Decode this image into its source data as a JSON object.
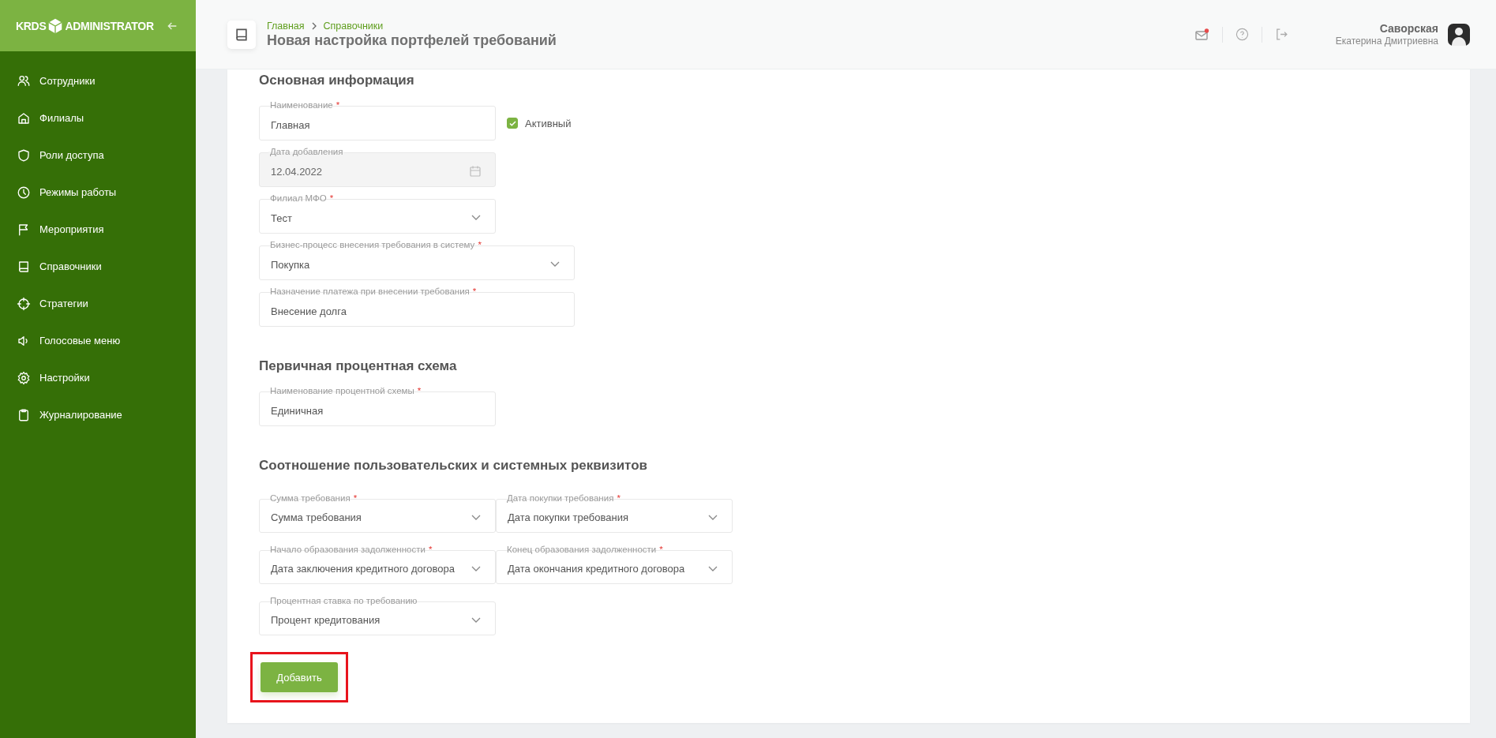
{
  "sidebar": {
    "logo_left": "KRDS",
    "logo_right": "ADMINISTRATOR",
    "items": [
      {
        "label": "Сотрудники",
        "selected": false
      },
      {
        "label": "Филиалы",
        "selected": false
      },
      {
        "label": "Роли доступа",
        "selected": false
      },
      {
        "label": "Режимы работы",
        "selected": false
      },
      {
        "label": "Мероприятия",
        "selected": false
      },
      {
        "label": "Справочники",
        "selected": false
      },
      {
        "label": "Стратегии",
        "selected": false
      },
      {
        "label": "Голосовые меню",
        "selected": false
      },
      {
        "label": "Настройки",
        "selected": false
      },
      {
        "label": "Журналирование",
        "selected": false
      }
    ]
  },
  "header": {
    "breadcrumbs": [
      "Главная",
      "Справочники"
    ],
    "title": "Новая настройка портфелей требований",
    "mail_unread": true,
    "user": {
      "surname": "Саворская",
      "name": "Екатерина Дмитриевна"
    }
  },
  "sections": [
    {
      "title": "Основная информация",
      "fields": [
        {
          "kind": "input",
          "label": "Наименование",
          "required_mark": "*",
          "disabled": false,
          "value": "Главная"
        },
        {
          "kind": "date",
          "label": "Дата добавления",
          "disabled": true,
          "value": "12.04.2022"
        },
        {
          "kind": "select",
          "label": "Филиал МФО",
          "required_mark": "*",
          "disabled": false,
          "value": "Тест"
        },
        {
          "kind": "select",
          "label": "Бизнес-процесс внесения требования в систему",
          "required_mark": "*",
          "disabled": false,
          "value": "Покупка"
        },
        {
          "kind": "input",
          "label": "Назначение платежа при внесении требования",
          "required_mark": "*",
          "disabled": false,
          "value": "Внесение долга"
        }
      ],
      "checkbox": {
        "label": "Активный",
        "checked": true
      }
    },
    {
      "title": "Первичная процентная схема",
      "fields": [
        {
          "kind": "input",
          "label": "Наименование процентной схемы",
          "required_mark": "*",
          "disabled": false,
          "value": "Единичная"
        }
      ]
    },
    {
      "title": "Соотношение пользовательских и системных реквизитов",
      "fields": [
        {
          "kind": "select",
          "label": "Сумма требования",
          "required_mark": "*",
          "disabled": false,
          "value": "Сумма требования"
        },
        {
          "kind": "select",
          "label": "Дата покупки требования",
          "required_mark": "*",
          "disabled": false,
          "value": "Дата покупки требования"
        },
        {
          "kind": "select",
          "label": "Начало образования задолженности",
          "required_mark": "*",
          "disabled": false,
          "value": "Дата заключения кредитного договора"
        },
        {
          "kind": "select",
          "label": "Конец образования задолженности",
          "required_mark": "*",
          "disabled": false,
          "value": "Дата окончания кредитного договора"
        },
        {
          "kind": "select",
          "label": "Процентная ставка по требованию",
          "disabled": false,
          "value": "Процент кредитования"
        }
      ]
    }
  ],
  "submit": {
    "label": "Добавить",
    "highlighted": true
  }
}
